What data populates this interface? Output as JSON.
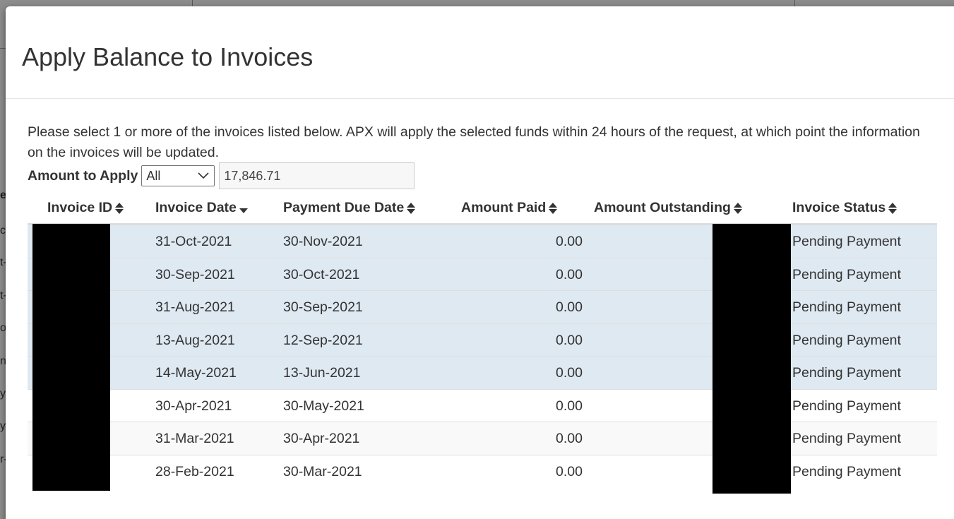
{
  "modal": {
    "title": "Apply Balance to Invoices",
    "intro": "Please select 1 or more of the invoices listed below. APX will apply the selected funds within 24 hours of the request, at which point the information on the invoices will be updated."
  },
  "apply": {
    "label": "Amount to Apply",
    "select_value": "All",
    "amount_value": "17,846.71"
  },
  "table": {
    "columns": [
      {
        "key": "id",
        "label": "Invoice ID",
        "sort": "both"
      },
      {
        "key": "date",
        "label": "Invoice Date",
        "sort": "desc"
      },
      {
        "key": "due",
        "label": "Payment Due Date",
        "sort": "both"
      },
      {
        "key": "paid",
        "label": "Amount Paid",
        "sort": "both"
      },
      {
        "key": "outstanding",
        "label": "Amount Outstanding",
        "sort": "both"
      },
      {
        "key": "status",
        "label": "Invoice Status",
        "sort": "both"
      }
    ],
    "rows": [
      {
        "date": "31-Oct-2021",
        "due": "30-Nov-2021",
        "paid": "0.00",
        "status": "Pending Payment",
        "selected": true
      },
      {
        "date": "30-Sep-2021",
        "due": "30-Oct-2021",
        "paid": "0.00",
        "status": "Pending Payment",
        "selected": true
      },
      {
        "date": "31-Aug-2021",
        "due": "30-Sep-2021",
        "paid": "0.00",
        "status": "Pending Payment",
        "selected": true
      },
      {
        "date": "13-Aug-2021",
        "due": "12-Sep-2021",
        "paid": "0.00",
        "status": "Pending Payment",
        "selected": true
      },
      {
        "date": "14-May-2021",
        "due": "13-Jun-2021",
        "paid": "0.00",
        "status": "Pending Payment",
        "selected": true
      },
      {
        "date": "30-Apr-2021",
        "due": "30-May-2021",
        "paid": "0.00",
        "status": "Pending Payment",
        "selected": false
      },
      {
        "date": "31-Mar-2021",
        "due": "30-Apr-2021",
        "paid": "0.00",
        "status": "Pending Payment",
        "selected": false
      },
      {
        "date": "28-Feb-2021",
        "due": "30-Mar-2021",
        "paid": "0.00",
        "status": "Pending Payment",
        "selected": false
      }
    ]
  },
  "background": {
    "edge_chars": [
      "e",
      "c",
      "t-",
      "t-",
      "o",
      "n-",
      "y",
      "y",
      "r-"
    ]
  },
  "colors": {
    "selected_row": "#dfe9f2",
    "striped_row": "#f9f9f9",
    "redaction": "#000000"
  }
}
